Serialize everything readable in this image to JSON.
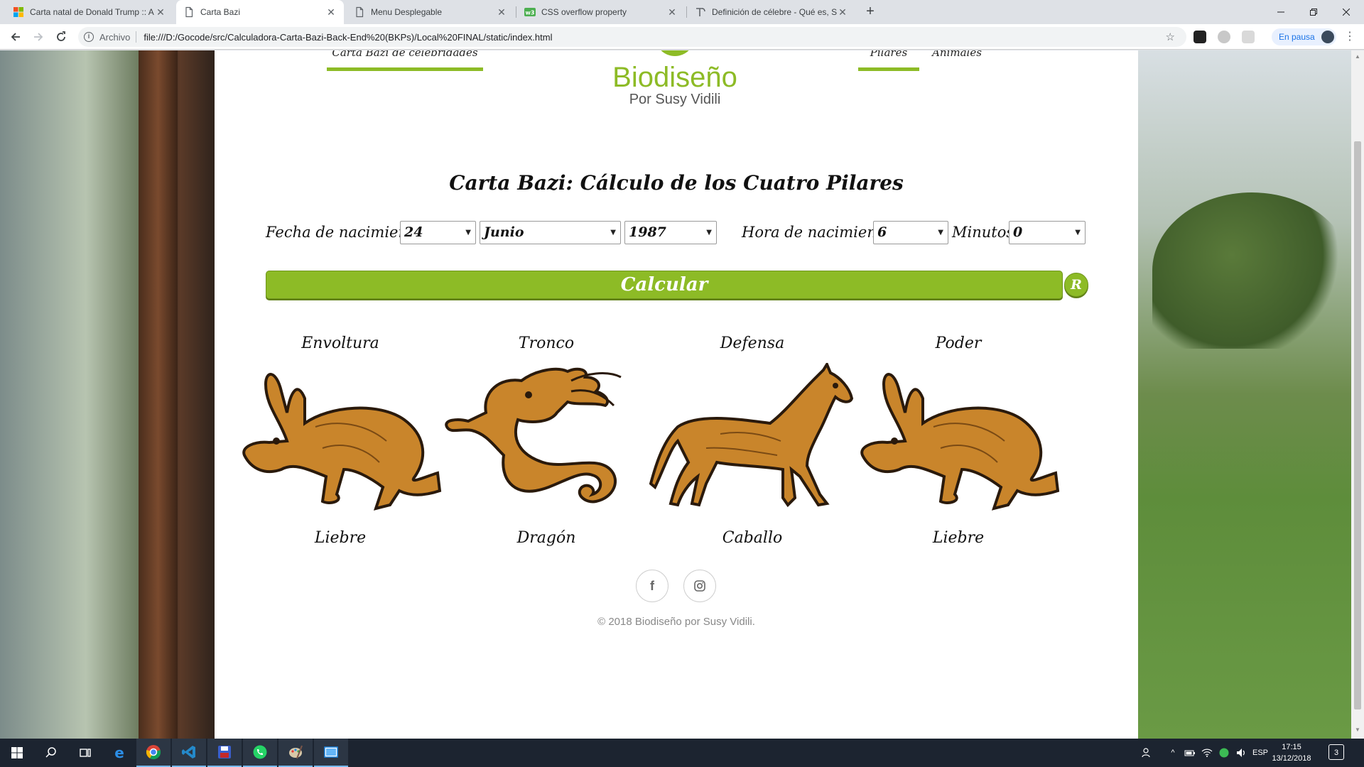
{
  "browser": {
    "tabs": [
      {
        "title": "Carta natal de Donald Trump :: A"
      },
      {
        "title": "Carta Bazi"
      },
      {
        "title": "Menu Desplegable"
      },
      {
        "title": "CSS overflow property"
      },
      {
        "title": "Definición de célebre - Qué es, S"
      }
    ],
    "new_tab": "+",
    "address": {
      "scheme": "Archivo",
      "url": "file:///D:/Gocode/src/Calculadora-Carta-Bazi-Back-End%20(BKPs)/Local%20FINAL/static/index.html"
    },
    "profile_status": "En pausa"
  },
  "header": {
    "nav_left": "Carta Bazi de celebridades",
    "logo_title": "Biodiseño",
    "logo_subtitle": "Por Susy Vidili",
    "nav_pilares": "Pilares",
    "nav_animales": "Animales"
  },
  "main": {
    "title": "Carta Bazi: Cálculo de los Cuatro Pilares",
    "birth_date_label": "Fecha de nacimiento:",
    "day": "24",
    "month": "Junio",
    "year": "1987",
    "birth_time_label": "Hora de nacimiento:",
    "hour": "6",
    "minutes_label": "Minutos:",
    "minutes": "0",
    "calc_button": "Calcular",
    "reset_button": "R"
  },
  "pillars": [
    {
      "label": "Envoltura",
      "animal": "Liebre",
      "icon": "hare-icon"
    },
    {
      "label": "Tronco",
      "animal": "Dragón",
      "icon": "dragon-icon"
    },
    {
      "label": "Defensa",
      "animal": "Caballo",
      "icon": "horse-icon"
    },
    {
      "label": "Poder",
      "animal": "Liebre",
      "icon": "hare-icon"
    }
  ],
  "footer": {
    "social": [
      "facebook-icon",
      "instagram-icon"
    ],
    "copyright": "© 2018 Biodiseño por Susy Vidili."
  },
  "taskbar": {
    "language": "ESP",
    "time": "17:15",
    "date": "13/12/2018",
    "notifications": "3"
  },
  "colors": {
    "accent": "#8dbb26",
    "animal_fill": "#c9852b",
    "animal_outline": "#2a1a0c"
  }
}
